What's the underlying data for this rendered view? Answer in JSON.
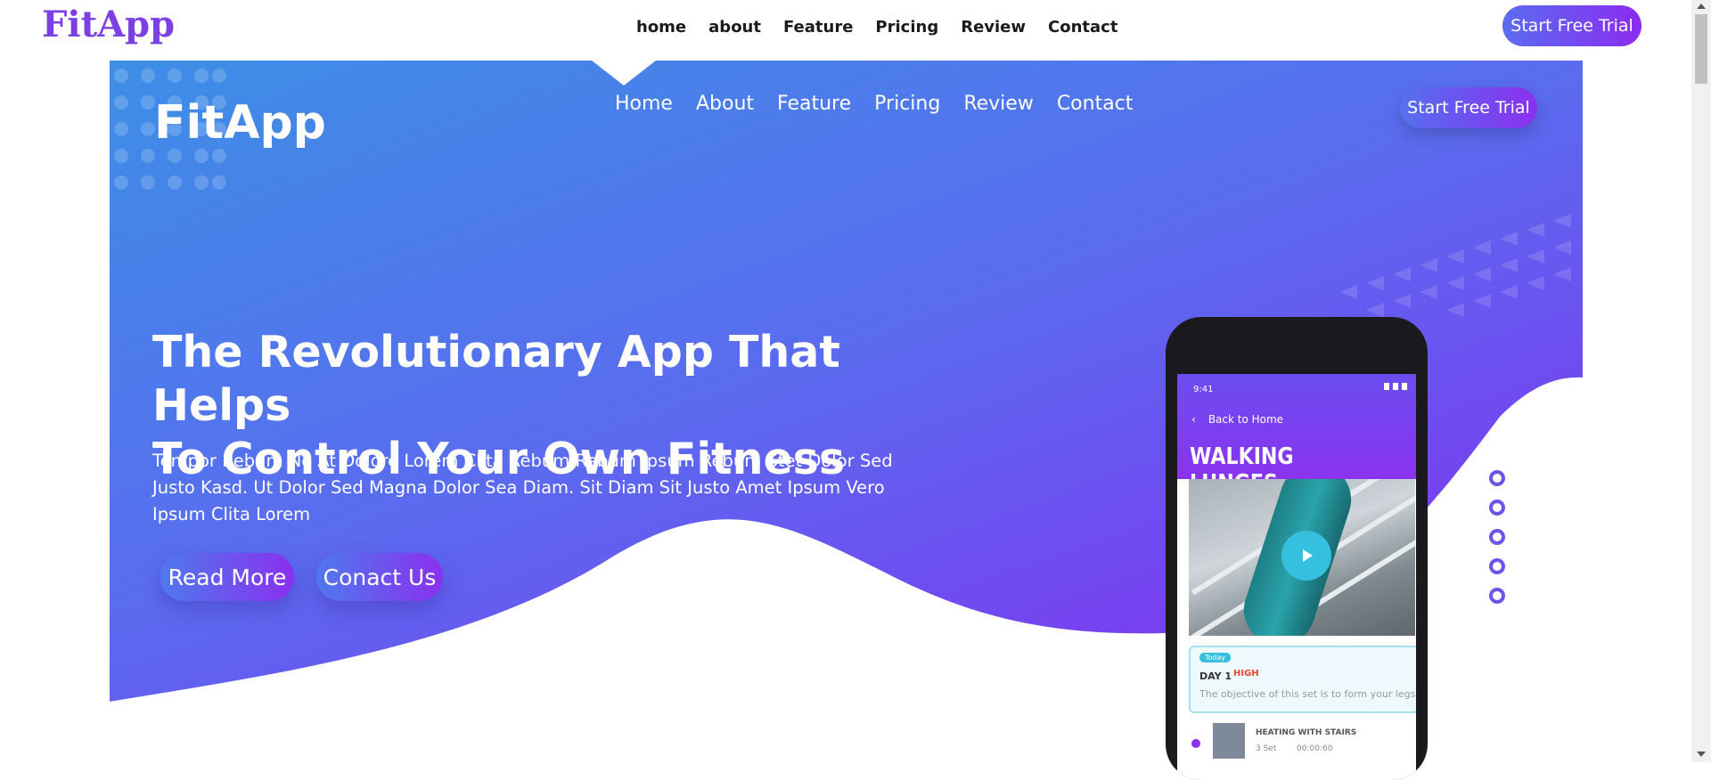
{
  "topbar": {
    "brand": "FitApp",
    "nav": [
      "home",
      "about",
      "Feature",
      "Pricing",
      "Review",
      "Contact"
    ],
    "cta": "Start Free Trial"
  },
  "hero": {
    "brand": "FitApp",
    "nav": [
      "Home",
      "About",
      "Feature",
      "Pricing",
      "Review",
      "Contact"
    ],
    "cta": "Start Free Trial",
    "headline_line1": "The Revolutionary App That Helps",
    "headline_line2": "To Control Your Own Fitness",
    "description": "Tempor Rebum No At Dolore Lorem Clita Rebum Rebum Ipsum Rebum Stet Dolor Sed Justo Kasd. Ut Dolor Sed Magna Dolor Sea Diam. Sit Diam Sit Justo Amet Ipsum Vero Ipsum Clita Lorem",
    "read_more": "Read More",
    "contact_us": "Conact Us"
  },
  "phone": {
    "time": "9:41",
    "back": "Back to Home",
    "title": "WALKING LUNGES",
    "tag": "Today",
    "day": "DAY 1",
    "level": "HIGH",
    "objective": "The objective of this set is to form your legs",
    "exercise_title": "HEATING WITH STAIRS",
    "exercise_sets": "3 Set",
    "exercise_time": "00:00:60"
  },
  "slider": {
    "count": 5
  },
  "colors": {
    "brand": "#7b3fe4",
    "gradient_start": "#3d8fe6",
    "gradient_end": "#8a2df0",
    "accent": "#36c0e0"
  }
}
